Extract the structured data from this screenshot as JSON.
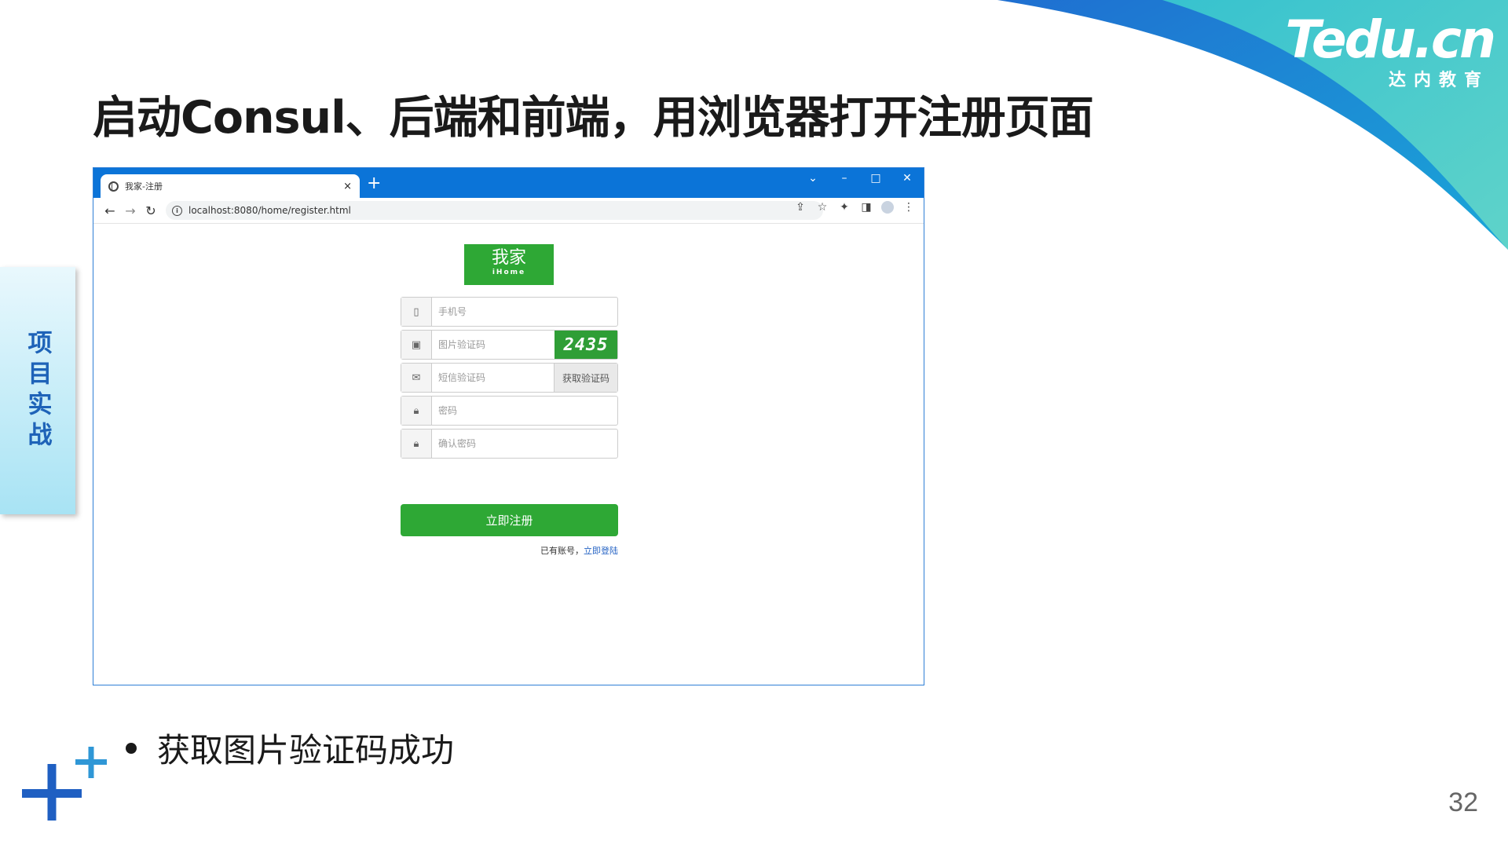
{
  "slide": {
    "title": "启动Consul、后端和前端，用浏览器打开注册页面",
    "side_tab": "项目实战",
    "bullet": "获取图片验证码成功",
    "page_number": "32",
    "brand_logo": "Tedu.cn",
    "brand_subtitle": "达内教育"
  },
  "browser": {
    "tab_title": "我家-注册",
    "tab_close": "×",
    "new_tab": "+",
    "window_controls": {
      "dropdown": "⌄",
      "minimize": "–",
      "maximize": "□",
      "close": "✕"
    },
    "url": "localhost:8080/home/register.html"
  },
  "page": {
    "logo_cn": "我家",
    "logo_en": "iHome",
    "fields": {
      "phone_placeholder": "手机号",
      "captcha_placeholder": "图片验证码",
      "captcha_value": "2435",
      "sms_placeholder": "短信验证码",
      "sms_button": "获取验证码",
      "password_placeholder": "密码",
      "confirm_placeholder": "确认密码"
    },
    "submit_label": "立即注册",
    "login_prompt": "已有账号，",
    "login_link": "立即登陆"
  },
  "colors": {
    "browser_accent": "#0b74d8",
    "brand_green": "#2ea835",
    "link_blue": "#2563c4",
    "side_tab_text": "#1e63b8"
  }
}
